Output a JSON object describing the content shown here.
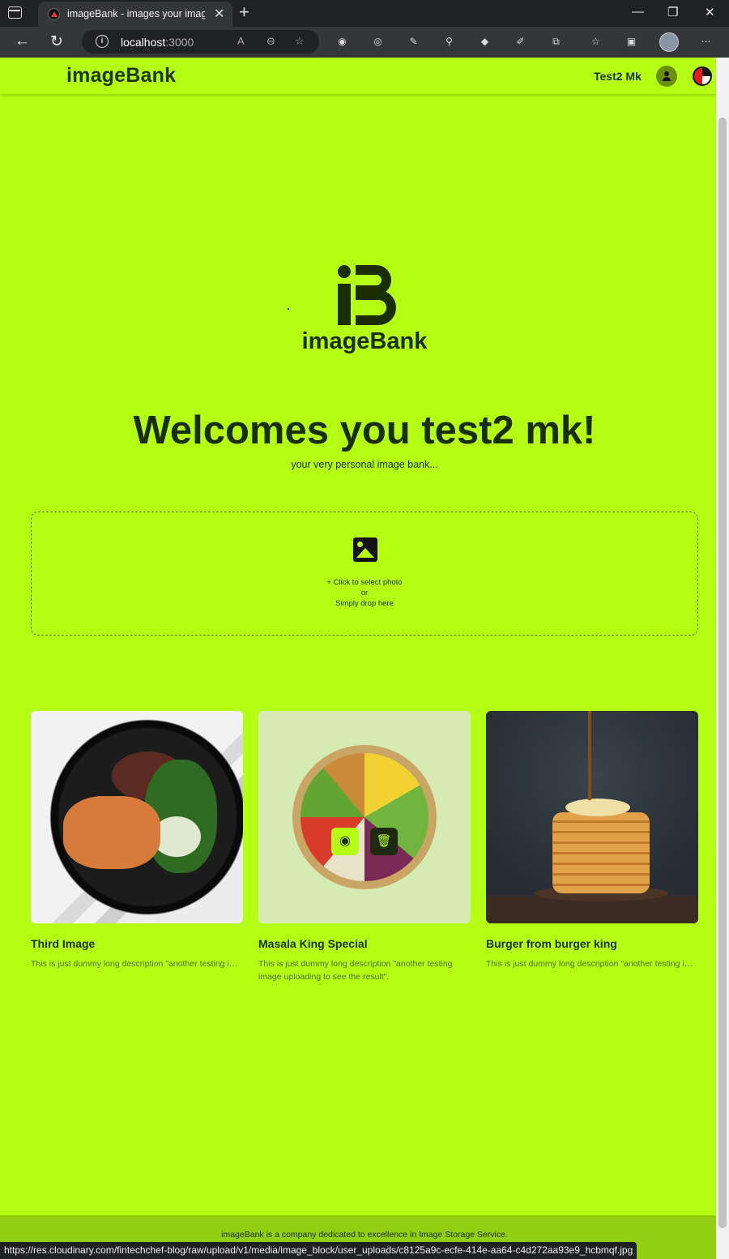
{
  "browser": {
    "tab_title": "imageBank - images your imagin",
    "url_host": "localhost",
    "url_port": ":3000",
    "status_url": "https://res.cloudinary.com/fintechchef-blog/raw/upload/v1/media/image_block/user_uploads/c8125a9c-ecfe-414e-aa64-c4d272aa93e9_hcbmqf.jpg"
  },
  "header": {
    "brand": "imageBank",
    "username": "Test2 Mk"
  },
  "hero": {
    "logo_text": "imageBank",
    "welcome": "Welcomes you test2 mk!",
    "tagline": "your very personal image bank..."
  },
  "dropzone": {
    "line1": "+ Click to select photo",
    "line2": "or",
    "line3": "Simply drop here"
  },
  "cards": [
    {
      "title": "Third Image",
      "description": "This is just dummy long description \"another testing image uploading to see the result\"."
    },
    {
      "title": "Masala King Special",
      "description": "This is just dummy long description \"another testing image uploading to see the result\"."
    },
    {
      "title": "Burger from burger king",
      "description": "This is just dummy long description \"another testing image uploading to see the result\"."
    }
  ],
  "footer": {
    "text": "imageBank is a company dedicated to excellence in Image Storage Service."
  },
  "colors": {
    "accent": "#b5ff14",
    "text_dark": "#1a2e00",
    "footer_bg": "#92cf12"
  }
}
